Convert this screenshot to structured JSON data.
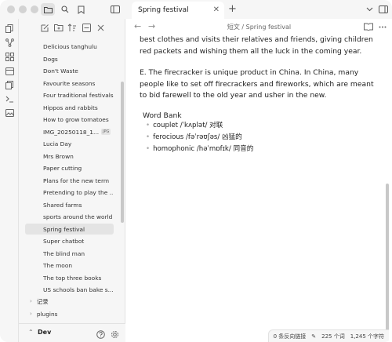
{
  "titlebar": {
    "tab_title": "Spring festival",
    "tab_close": "✕",
    "tab_add": "+"
  },
  "sidebar": {
    "files": [
      {
        "label": "Delicious tanghulu"
      },
      {
        "label": "Dogs"
      },
      {
        "label": "Don't Waste"
      },
      {
        "label": "Favourite seasons"
      },
      {
        "label": "Four traditional festivals"
      },
      {
        "label": "Hippos and rabbits"
      },
      {
        "label": "How to grow tomatoes"
      },
      {
        "label": "IMG_20250118_1...",
        "badge": "JPG"
      },
      {
        "label": "Lucia Day"
      },
      {
        "label": "Mrs Brown"
      },
      {
        "label": "Paper cutting"
      },
      {
        "label": "Plans for the new term"
      },
      {
        "label": "Pretending to play the ..."
      },
      {
        "label": "Shared farms"
      },
      {
        "label": "sports around the world"
      },
      {
        "label": "Spring festival",
        "active": true
      },
      {
        "label": "Super chatbot"
      },
      {
        "label": "The blind man"
      },
      {
        "label": "The moon"
      },
      {
        "label": "The top three books"
      },
      {
        "label": "US schools ban bake s..."
      }
    ],
    "folders": [
      {
        "label": "记录"
      },
      {
        "label": "plugins"
      }
    ],
    "vault_name": "Dev"
  },
  "editor": {
    "breadcrumb": "短文 / Spring festival",
    "para1": "best clothes and visits their relatives and friends, giving children red packets and wishing them all the luck in the coming year.",
    "para2": "E. The firecracker is unique product in China. In China, many people like to set off firecrackers and fireworks, which are meant to bid farewell to the old year and usher in the new.",
    "word_bank_title": "Word Bank",
    "word_bank": [
      "couplet /ˈkʌplət/  对联",
      "ferocious /fəˈrəʊʃəs/ 凶猛的",
      "homophonic /həˈmɒfɪk/ 同音的"
    ]
  },
  "statusbar": {
    "backlinks": "0 条反向链接",
    "words": "225 个词",
    "chars": "1,245 个字符"
  },
  "colors": {
    "sidebar_bg": "#f6f6f6",
    "active_item_bg": "#e4e4e4",
    "editor_bg": "#ffffff"
  }
}
